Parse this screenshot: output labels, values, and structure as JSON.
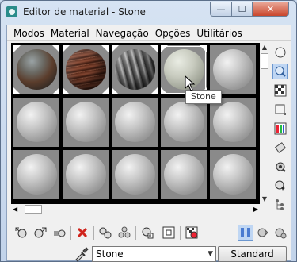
{
  "window": {
    "title": "Editor de material - Stone",
    "controls": {
      "minimize": "—",
      "maximize": "☐",
      "close": "✕"
    }
  },
  "menu": [
    "Modos",
    "Material",
    "Navegação",
    "Opções",
    "Utilitários"
  ],
  "tooltip": "Stone",
  "material_name": "Stone",
  "material_type_button": "Standard",
  "colors": {
    "title_bar": "#c2d3ea",
    "close_button": "#c9462c",
    "pressed_button": "#bfd6f3"
  },
  "slots": [
    {
      "material": "rock"
    },
    {
      "material": "wood"
    },
    {
      "material": "metal"
    },
    {
      "material": "stone",
      "active": true
    },
    {
      "material": "default"
    },
    {
      "material": "default"
    },
    {
      "material": "default"
    },
    {
      "material": "default"
    },
    {
      "material": "default"
    },
    {
      "material": "default"
    },
    {
      "material": "default"
    },
    {
      "material": "default"
    },
    {
      "material": "default"
    },
    {
      "material": "default"
    },
    {
      "material": "default"
    }
  ],
  "right_toolbar_icons": [
    "sample-type-icon",
    "backlight-icon",
    "background-checker-icon",
    "sample-uv-tiling-icon",
    "video-color-check-icon",
    "make-preview-icon",
    "options-icon",
    "select-by-material-icon",
    "material-map-navigator-icon"
  ],
  "bottom_toolbar_icons": [
    "get-material-icon",
    "put-to-scene-icon",
    "assign-to-selection-icon",
    "reset-map-icon",
    "make-unique-icon",
    "put-to-library-icon",
    "material-id-channel-icon",
    "show-map-in-viewport-icon",
    "show-end-result-icon",
    "go-to-parent-icon",
    "go-forward-sibling-icon"
  ]
}
